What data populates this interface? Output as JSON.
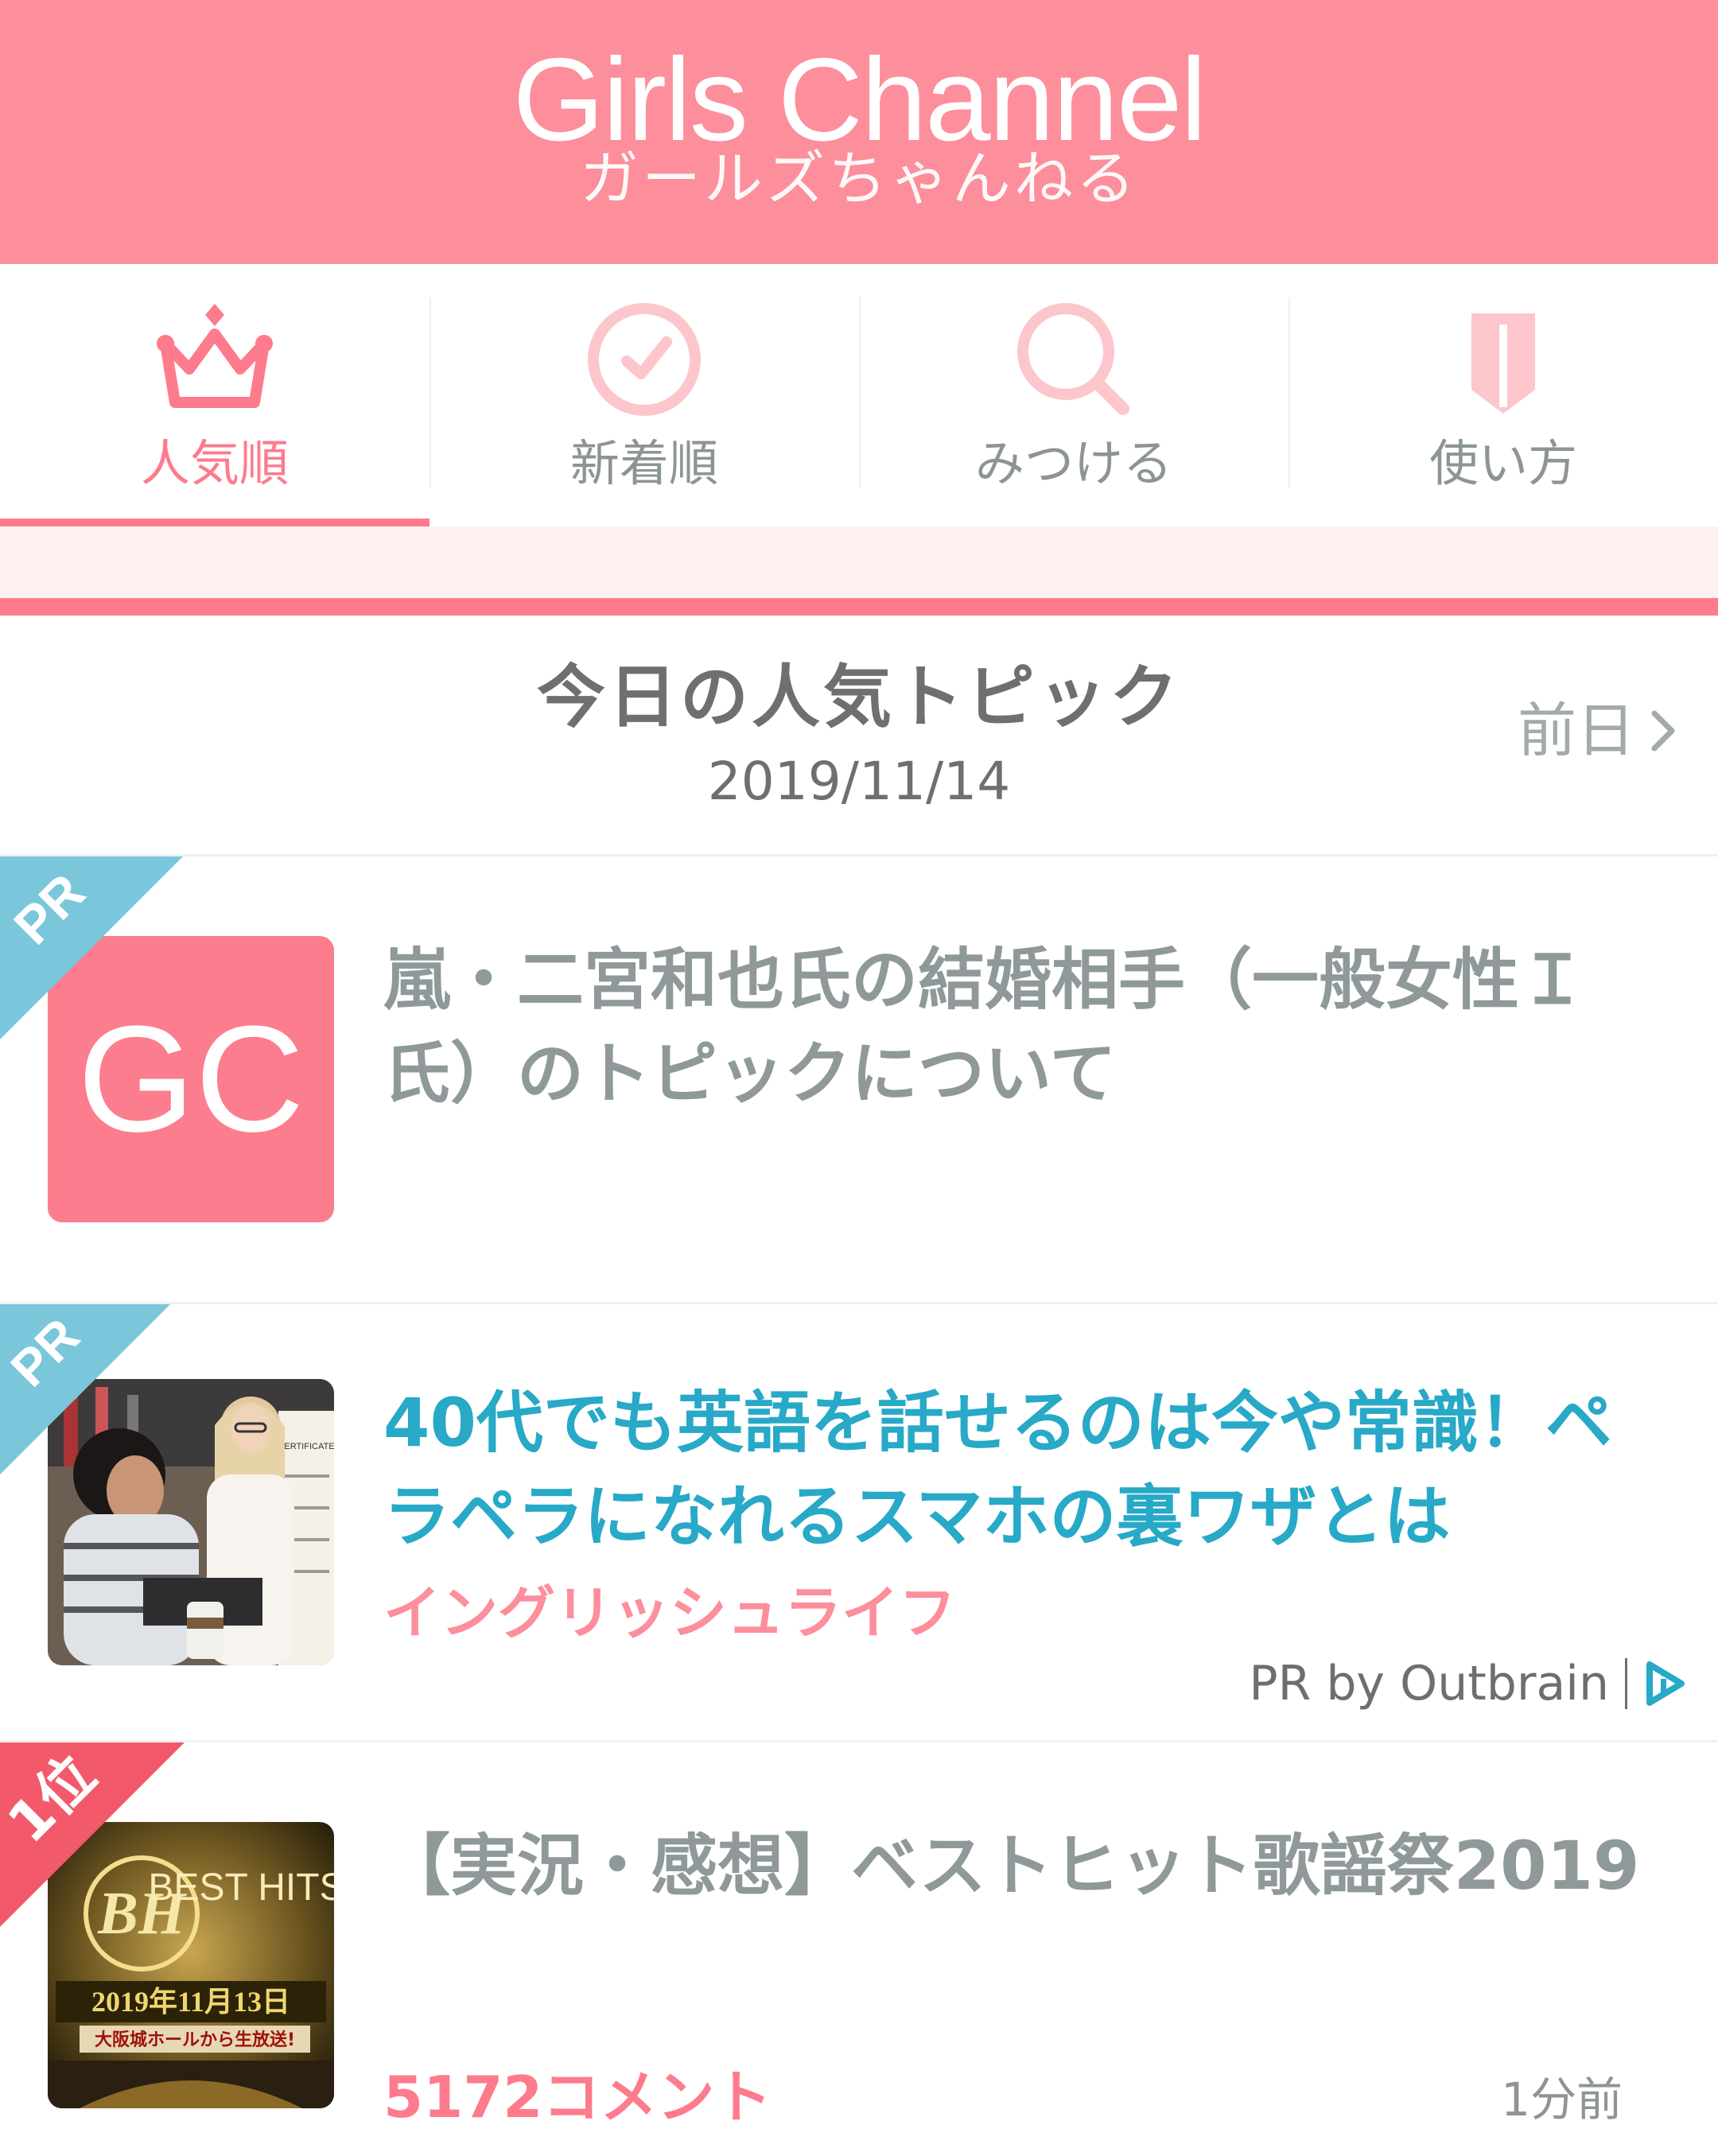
{
  "header": {
    "logo_title": "Girls Channel",
    "logo_subtitle": "ガールズちゃんねる"
  },
  "nav": {
    "items": [
      {
        "label": "人気順",
        "icon": "crown-icon",
        "active": true
      },
      {
        "label": "新着順",
        "icon": "clock-icon",
        "active": false
      },
      {
        "label": "みつける",
        "icon": "search-icon",
        "active": false
      },
      {
        "label": "使い方",
        "icon": "book-icon",
        "active": false
      }
    ]
  },
  "today": {
    "title": "今日の人気トピック",
    "date": "2019/11/14",
    "prev_label": "前日"
  },
  "items": [
    {
      "badge": "PR",
      "thumb_text": "GC",
      "title": "嵐・二宮和也氏の結婚相手（一般女性Ｉ氏）のトピックについて"
    },
    {
      "badge": "PR",
      "title": "40代でも英語を話せるのは今や常識！ペラペラになれるスマホの裏ワザとは",
      "sponsor": "イングリッシュライフ",
      "outbrain_label": "PR by Outbrain",
      "thumb_caption": "CERTIFICATE"
    },
    {
      "badge": "1位",
      "title": "【実況・感想】ベストヒット歌謡祭2019",
      "comments": "5172コメント",
      "time": "1分前",
      "thumb_text_1": "BEST HITS",
      "thumb_text_2": "2019年11月13日",
      "thumb_text_3": "大阪城ホールから生放送!"
    }
  ],
  "colors": {
    "brand_pink": "#fd8e9b",
    "accent_pink": "#fd7b8c",
    "pr_blue": "#7ac6db",
    "link_blue": "#27a9c7",
    "rank_red": "#f25a6b"
  }
}
